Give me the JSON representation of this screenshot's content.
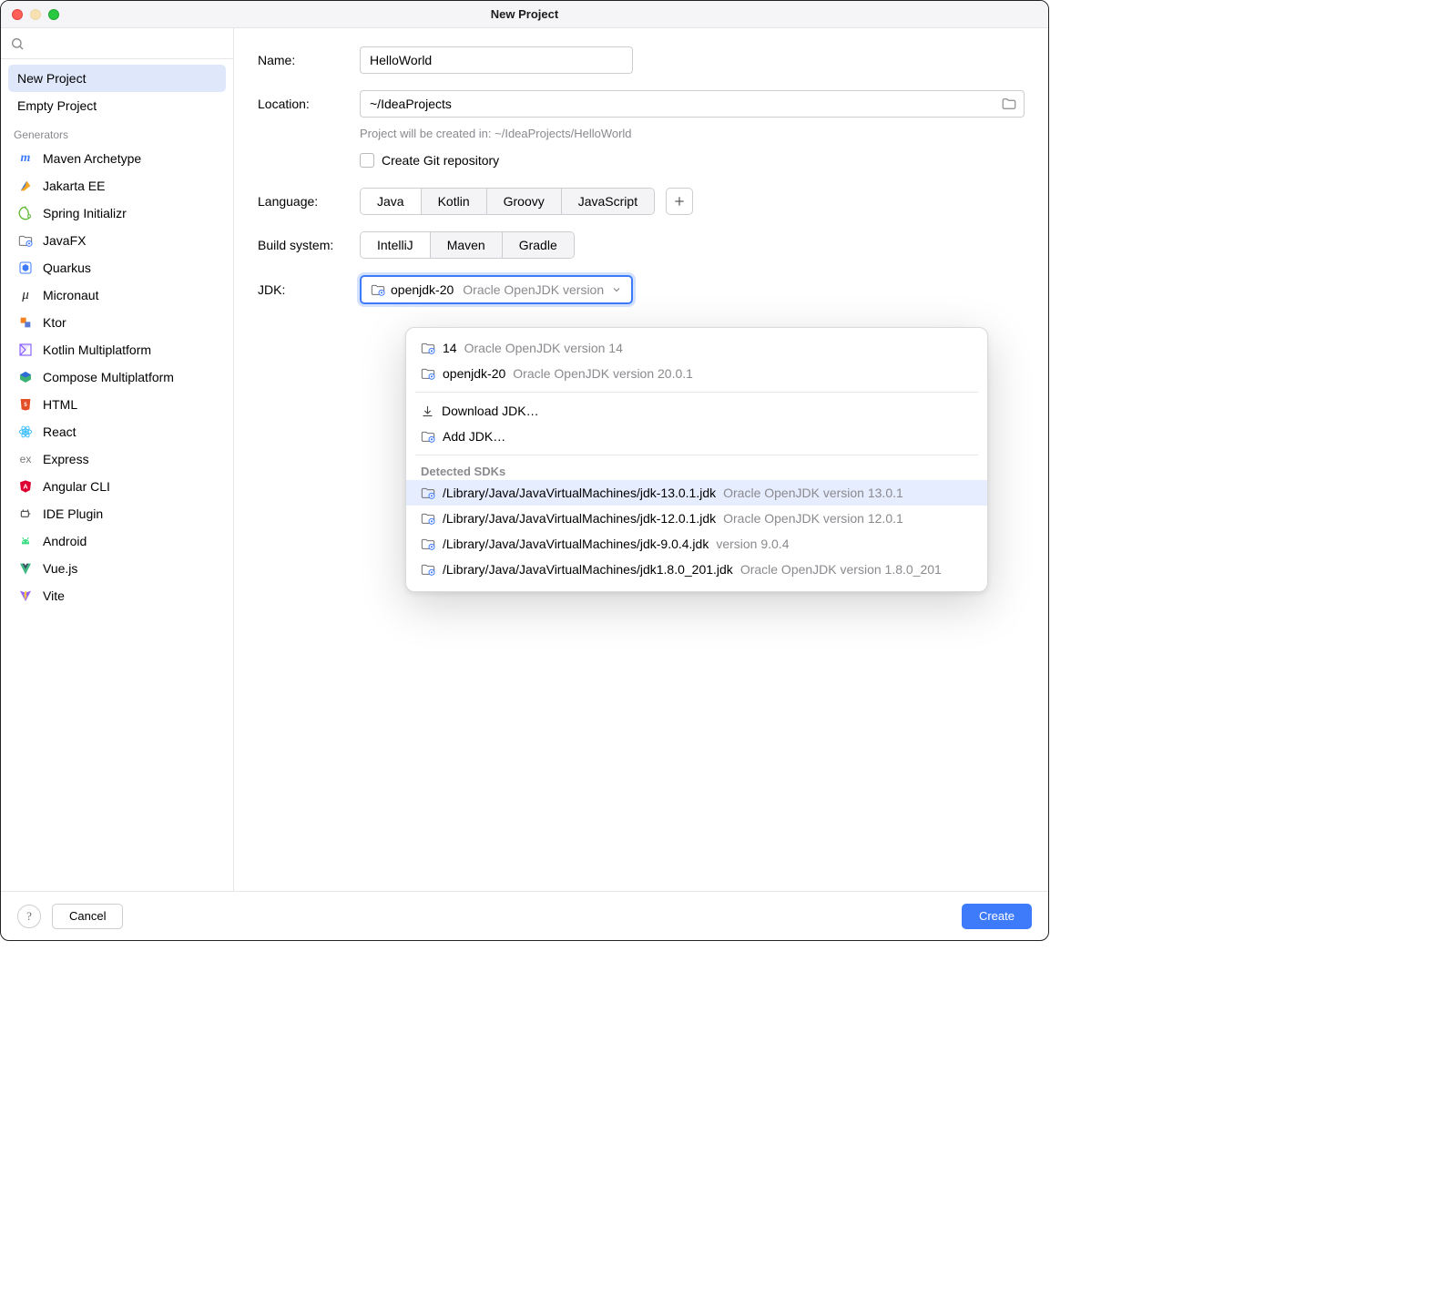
{
  "window": {
    "title": "New Project"
  },
  "sidebar": {
    "search_placeholder": "",
    "top_items": [
      {
        "label": "New Project",
        "selected": true
      },
      {
        "label": "Empty Project",
        "selected": false
      }
    ],
    "generators_label": "Generators",
    "generators": [
      {
        "label": "Maven Archetype",
        "icon": "maven"
      },
      {
        "label": "Jakarta EE",
        "icon": "jakarta"
      },
      {
        "label": "Spring Initializr",
        "icon": "spring"
      },
      {
        "label": "JavaFX",
        "icon": "javafx"
      },
      {
        "label": "Quarkus",
        "icon": "quarkus"
      },
      {
        "label": "Micronaut",
        "icon": "micronaut"
      },
      {
        "label": "Ktor",
        "icon": "ktor"
      },
      {
        "label": "Kotlin Multiplatform",
        "icon": "kotlin"
      },
      {
        "label": "Compose Multiplatform",
        "icon": "compose"
      },
      {
        "label": "HTML",
        "icon": "html"
      },
      {
        "label": "React",
        "icon": "react"
      },
      {
        "label": "Express",
        "icon": "express"
      },
      {
        "label": "Angular CLI",
        "icon": "angular"
      },
      {
        "label": "IDE Plugin",
        "icon": "ideplugin"
      },
      {
        "label": "Android",
        "icon": "android"
      },
      {
        "label": "Vue.js",
        "icon": "vue"
      },
      {
        "label": "Vite",
        "icon": "vite"
      }
    ]
  },
  "form": {
    "name_label": "Name:",
    "name_value": "HelloWorld",
    "location_label": "Location:",
    "location_value": "~/IdeaProjects",
    "location_hint": "Project will be created in: ~/IdeaProjects/HelloWorld",
    "git_checkbox_label": "Create Git repository",
    "git_checked": false,
    "language_label": "Language:",
    "languages": [
      {
        "label": "Java",
        "selected": true
      },
      {
        "label": "Kotlin",
        "selected": false
      },
      {
        "label": "Groovy",
        "selected": false
      },
      {
        "label": "JavaScript",
        "selected": false
      }
    ],
    "build_label": "Build system:",
    "builds": [
      {
        "label": "IntelliJ",
        "selected": true
      },
      {
        "label": "Maven",
        "selected": false
      },
      {
        "label": "Gradle",
        "selected": false
      }
    ],
    "jdk_label": "JDK:",
    "jdk_selected_name": "openjdk-20",
    "jdk_selected_desc": "Oracle OpenJDK version"
  },
  "jdk_dropdown": {
    "existing": [
      {
        "name": "14",
        "desc": "Oracle OpenJDK version 14"
      },
      {
        "name": "openjdk-20",
        "desc": "Oracle OpenJDK version 20.0.1"
      }
    ],
    "download_label": "Download JDK…",
    "add_label": "Add JDK…",
    "detected_label": "Detected SDKs",
    "detected": [
      {
        "path": "/Library/Java/JavaVirtualMachines/jdk-13.0.1.jdk",
        "desc": "Oracle OpenJDK version 13.0.1",
        "highlighted": true
      },
      {
        "path": "/Library/Java/JavaVirtualMachines/jdk-12.0.1.jdk",
        "desc": "Oracle OpenJDK version 12.0.1",
        "highlighted": false
      },
      {
        "path": "/Library/Java/JavaVirtualMachines/jdk-9.0.4.jdk",
        "desc": "version 9.0.4",
        "highlighted": false
      },
      {
        "path": "/Library/Java/JavaVirtualMachines/jdk1.8.0_201.jdk",
        "desc": "Oracle OpenJDK version 1.8.0_201",
        "highlighted": false
      }
    ]
  },
  "footer": {
    "cancel_label": "Cancel",
    "create_label": "Create"
  }
}
